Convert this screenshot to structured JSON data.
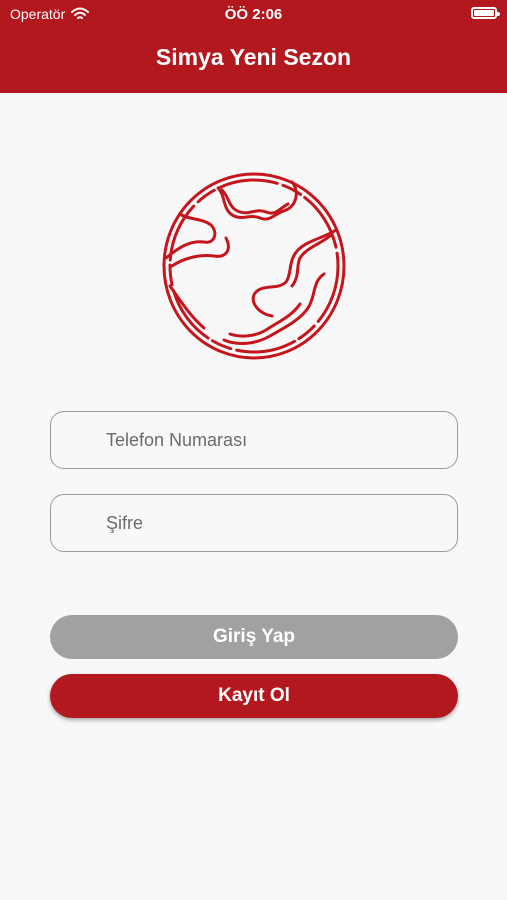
{
  "status_bar": {
    "carrier": "Operatör",
    "time": "ÖÖ 2:06",
    "battery_level": 1.0
  },
  "header": {
    "title": "Simya Yeni Sezon"
  },
  "form": {
    "phone_placeholder": "Telefon Numarası",
    "password_placeholder": "Şifre"
  },
  "buttons": {
    "login_label": "Giriş Yap",
    "register_label": "Kayıt Ol"
  },
  "colors": {
    "brand": "#b2181d",
    "disabled_button": "#a1a1a1",
    "background": "#f8f8f8"
  },
  "icons": {
    "logo": "globe-icon",
    "wifi": "wifi-icon",
    "battery": "battery-icon"
  }
}
